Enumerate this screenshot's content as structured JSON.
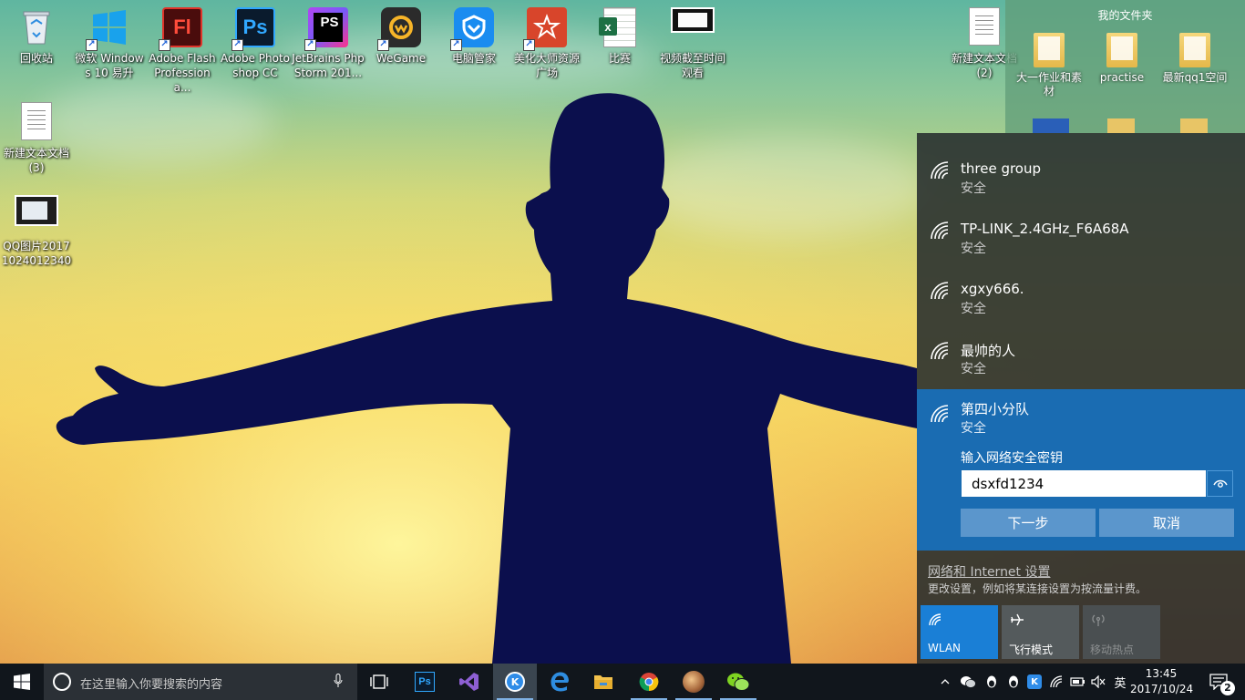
{
  "desktop": {
    "icons": [
      {
        "label": "回收站",
        "icon": "recycle-bin-icon"
      },
      {
        "label": "微软 Windows 10 易升",
        "icon": "windows-logo-icon"
      },
      {
        "label": "Adobe Flash Professiona...",
        "icon": "adobe-flash-icon",
        "mark": "Fl"
      },
      {
        "label": "Adobe Photoshop CC",
        "icon": "photoshop-icon",
        "mark": "Ps"
      },
      {
        "label": "JetBrains PhpStorm 201...",
        "icon": "phpstorm-icon",
        "mark": "PS"
      },
      {
        "label": "WeGame",
        "icon": "wegame-icon"
      },
      {
        "label": "电脑管家",
        "icon": "pc-manager-icon"
      },
      {
        "label": "美化大师资源广场",
        "icon": "beautify-master-icon"
      },
      {
        "label": "比赛",
        "icon": "excel-file-icon",
        "mark": "x"
      },
      {
        "label": "视频截至时间观看",
        "icon": "image-file-icon"
      },
      {
        "label": "新建文本文档 (2)",
        "icon": "text-document-icon"
      },
      {
        "label": "新建文本文档 (3)",
        "icon": "text-document-icon"
      },
      {
        "label": "QQ图片20171024012340",
        "icon": "image-file-icon"
      }
    ],
    "folder_window": {
      "title": "我的文件夹",
      "items": [
        {
          "label": "大一作业和素材",
          "icon": "folder-icon"
        },
        {
          "label": "practise",
          "icon": "folder-icon"
        },
        {
          "label": "最新qq1空间",
          "icon": "folder-icon"
        }
      ]
    }
  },
  "network_flyout": {
    "networks": [
      {
        "ssid": "three group",
        "status": "安全"
      },
      {
        "ssid": "TP-LINK_2.4GHz_F6A68A",
        "status": "安全"
      },
      {
        "ssid": "xgxy666.",
        "status": "安全"
      },
      {
        "ssid": "最帅的人",
        "status": "安全"
      }
    ],
    "selected": {
      "ssid": "第四小分队",
      "status": "安全",
      "key_label": "输入网络安全密钥",
      "key_value": "dsxfd1234",
      "next_label": "下一步",
      "cancel_label": "取消"
    },
    "settings_link": "网络和 Internet 设置",
    "settings_desc": "更改设置，例如将某连接设置为按流量计费。",
    "quick_actions": [
      {
        "label": "WLAN",
        "icon": "wifi-icon",
        "on": true
      },
      {
        "label": "飞行模式",
        "icon": "airplane-icon",
        "on": false
      },
      {
        "label": "移动热点",
        "icon": "hotspot-icon",
        "on": false,
        "disabled": true
      }
    ]
  },
  "taskbar": {
    "search_placeholder": "在这里输入你要搜索的内容",
    "ime": "英",
    "time": "13:45",
    "date": "2017/10/24",
    "notification_count": "2",
    "pinned": [
      "task-view-icon",
      "photoshop-icon",
      "visual-studio-icon",
      "k-app-icon",
      "edge-icon",
      "file-explorer-icon",
      "chrome-icon",
      "game-icon",
      "wechat-icon"
    ]
  },
  "colors": {
    "accent": "#1a6cb2",
    "flyout_bg": "#262c2e",
    "taskbar_bg": "#11161c"
  }
}
